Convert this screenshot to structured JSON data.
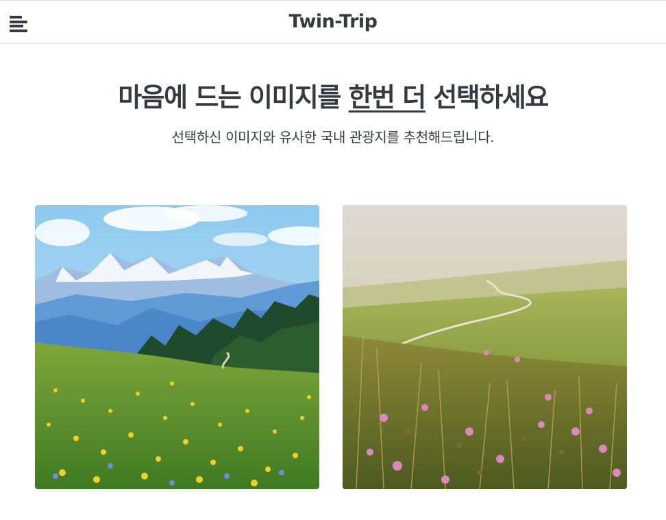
{
  "header": {
    "title": "Twin-Trip",
    "menu_icon": "hamburger-menu-icon"
  },
  "hero": {
    "headline_pre": "마음에 드는 이미지를 ",
    "headline_highlight": "한번 더",
    "headline_post": " 선택하세요",
    "subtitle": "선택하신 이미지와 유사한 국내 관광지를 추천해드립니다."
  },
  "choices": [
    {
      "name": "alpine-meadow-yellow-flowers"
    },
    {
      "name": "misty-hillside-pink-flowers"
    }
  ],
  "colors": {
    "text": "#343a40",
    "border": "#dcdcdc",
    "background": "#ffffff"
  }
}
